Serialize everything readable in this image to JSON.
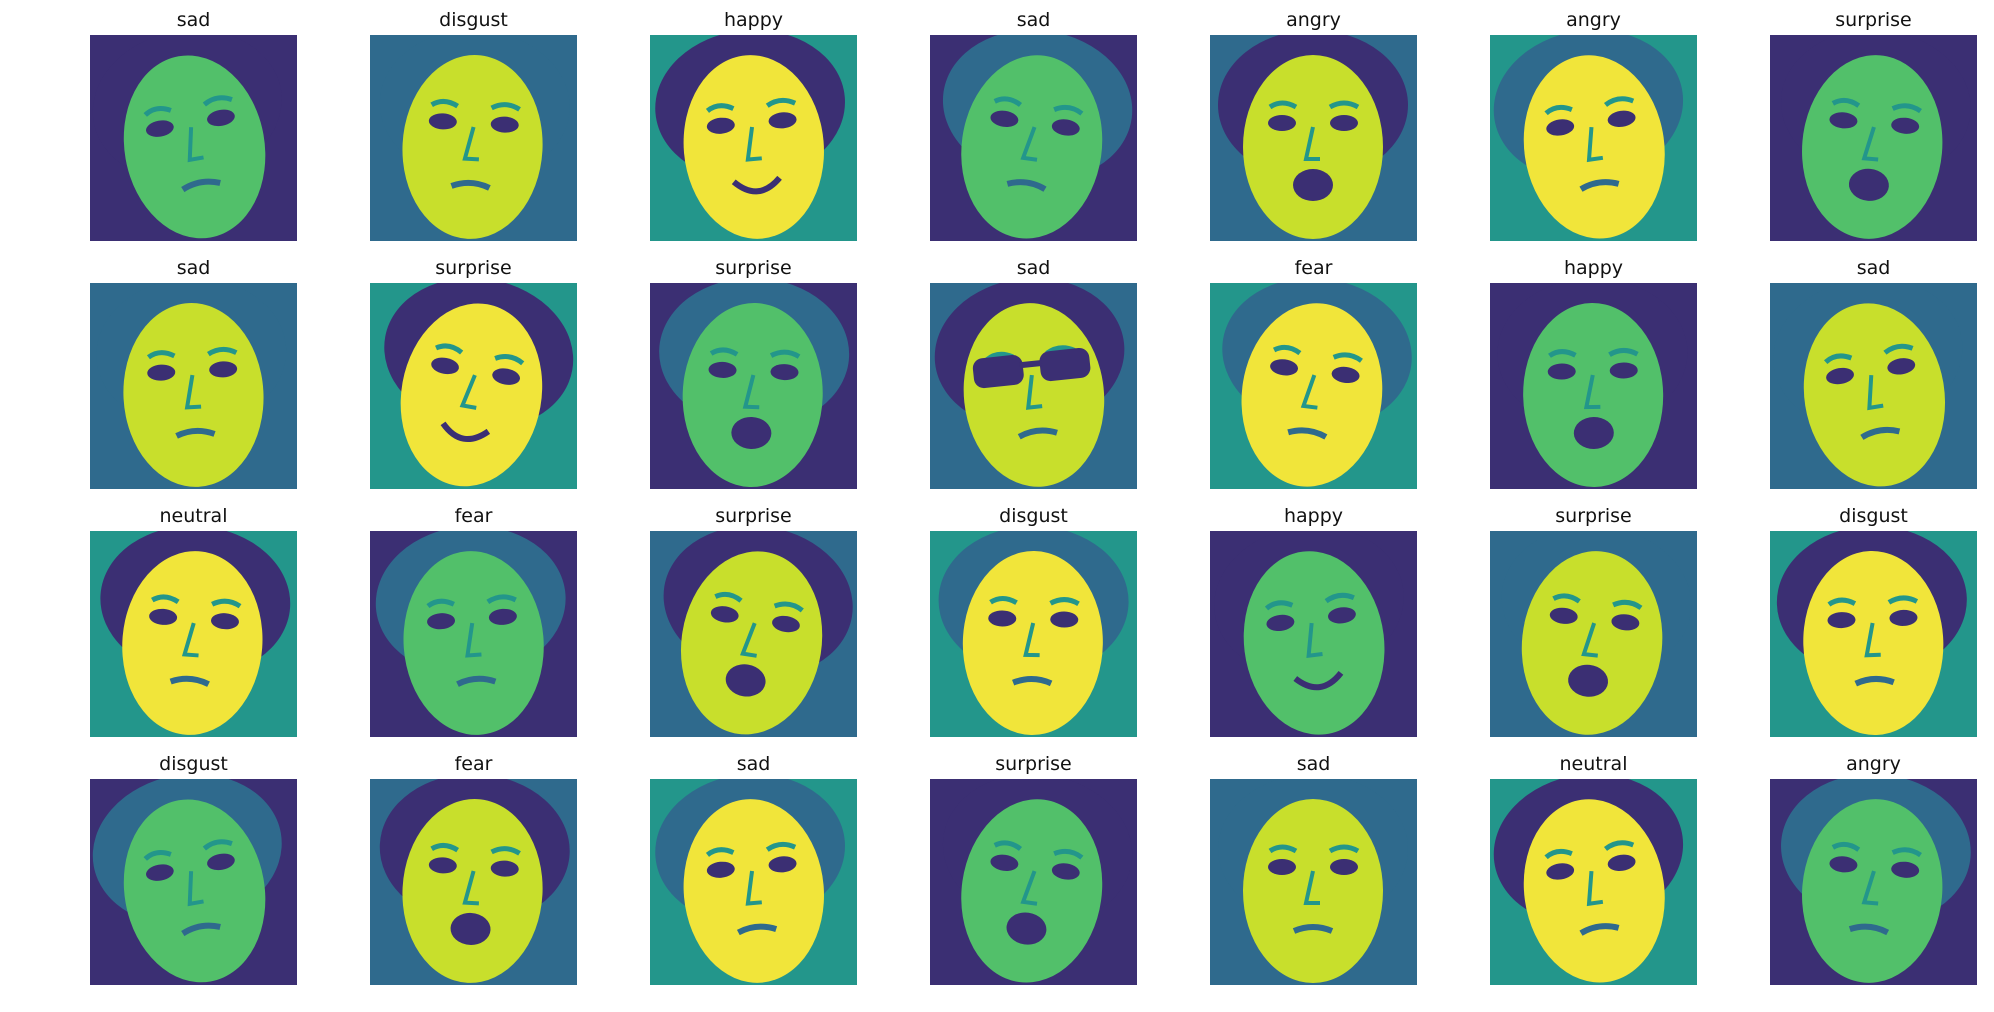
{
  "grid": {
    "rows": 4,
    "columns": 7,
    "panels": [
      {
        "label": "sad"
      },
      {
        "label": "disgust"
      },
      {
        "label": "happy"
      },
      {
        "label": "sad"
      },
      {
        "label": "angry"
      },
      {
        "label": "angry"
      },
      {
        "label": "surprise"
      },
      {
        "label": "sad"
      },
      {
        "label": "surprise"
      },
      {
        "label": "surprise"
      },
      {
        "label": "sad"
      },
      {
        "label": "fear"
      },
      {
        "label": "happy"
      },
      {
        "label": "sad"
      },
      {
        "label": "neutral"
      },
      {
        "label": "fear"
      },
      {
        "label": "surprise"
      },
      {
        "label": "disgust"
      },
      {
        "label": "happy"
      },
      {
        "label": "surprise"
      },
      {
        "label": "disgust"
      },
      {
        "label": "disgust"
      },
      {
        "label": "fear"
      },
      {
        "label": "sad"
      },
      {
        "label": "surprise"
      },
      {
        "label": "sad"
      },
      {
        "label": "neutral"
      },
      {
        "label": "angry"
      }
    ]
  },
  "colors": {
    "colormap": "viridis",
    "dark": "#3b2f73",
    "mid_dark": "#2f6a8d",
    "mid": "#23968b",
    "mid_light": "#52c06a",
    "light": "#c8df2c",
    "bright": "#f1e53a"
  }
}
